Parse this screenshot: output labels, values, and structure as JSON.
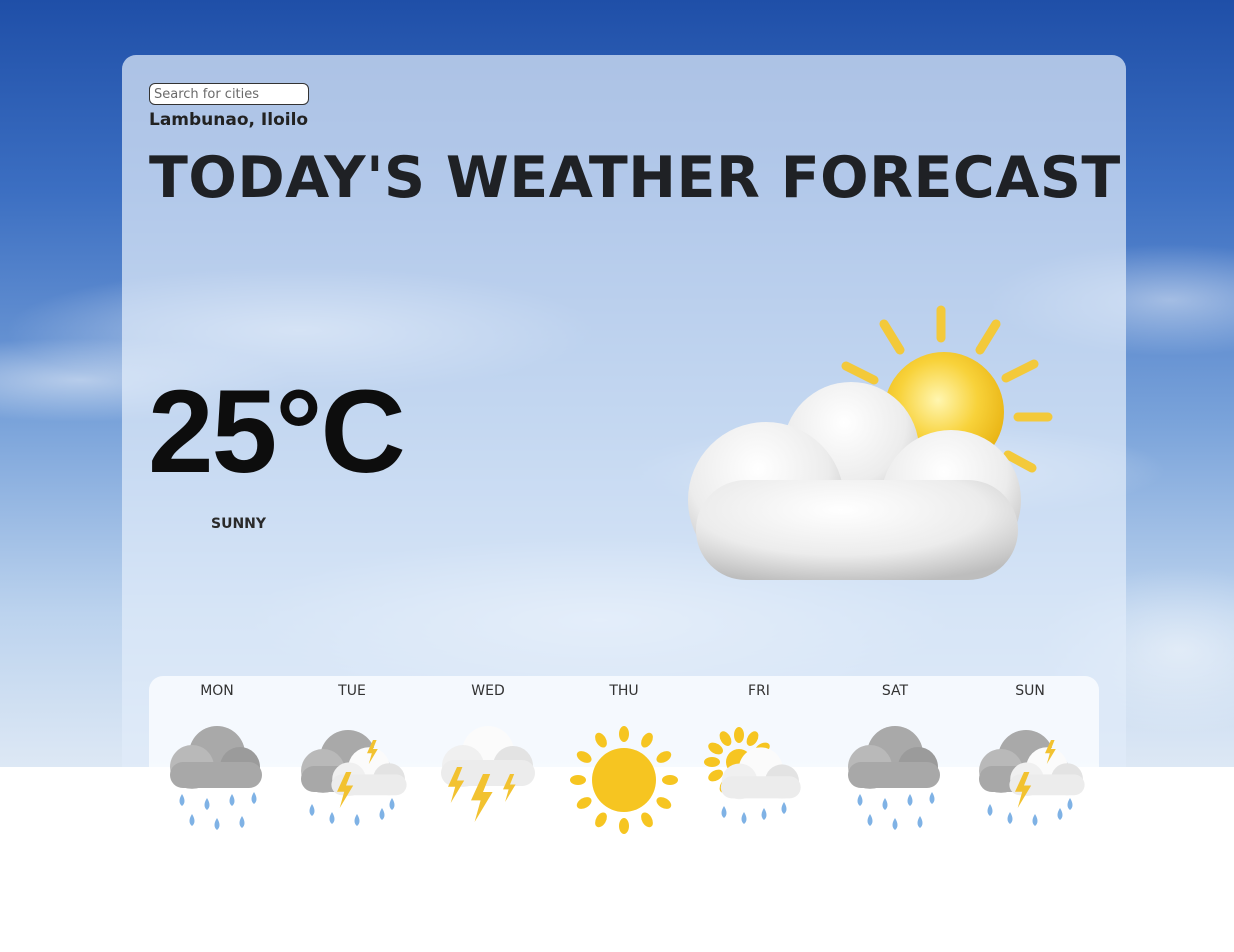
{
  "search": {
    "placeholder": "Search for cities",
    "value": ""
  },
  "location": "Lambunao, Iloilo",
  "headline": "TODAY'S WEATHER FORECAST",
  "current": {
    "temperature": "25°C",
    "condition": "SUNNY",
    "icon": "sun-behind-cloud-icon"
  },
  "forecast": [
    {
      "day": "MON",
      "icon": "rain-cloud-icon"
    },
    {
      "day": "TUE",
      "icon": "thunder-rain-cloud-icon"
    },
    {
      "day": "WED",
      "icon": "thunder-cloud-icon"
    },
    {
      "day": "THU",
      "icon": "sun-icon"
    },
    {
      "day": "FRI",
      "icon": "sun-cloud-rain-icon"
    },
    {
      "day": "SAT",
      "icon": "rain-cloud-icon"
    },
    {
      "day": "SUN",
      "icon": "thunder-rain-cloud-icon"
    }
  ],
  "colors": {
    "sun": "#f6c521",
    "cloud": "#f2f2f2",
    "grey_cloud": "#a9a9a9",
    "rain": "#7fb2e5",
    "lightning": "#f2c230"
  }
}
